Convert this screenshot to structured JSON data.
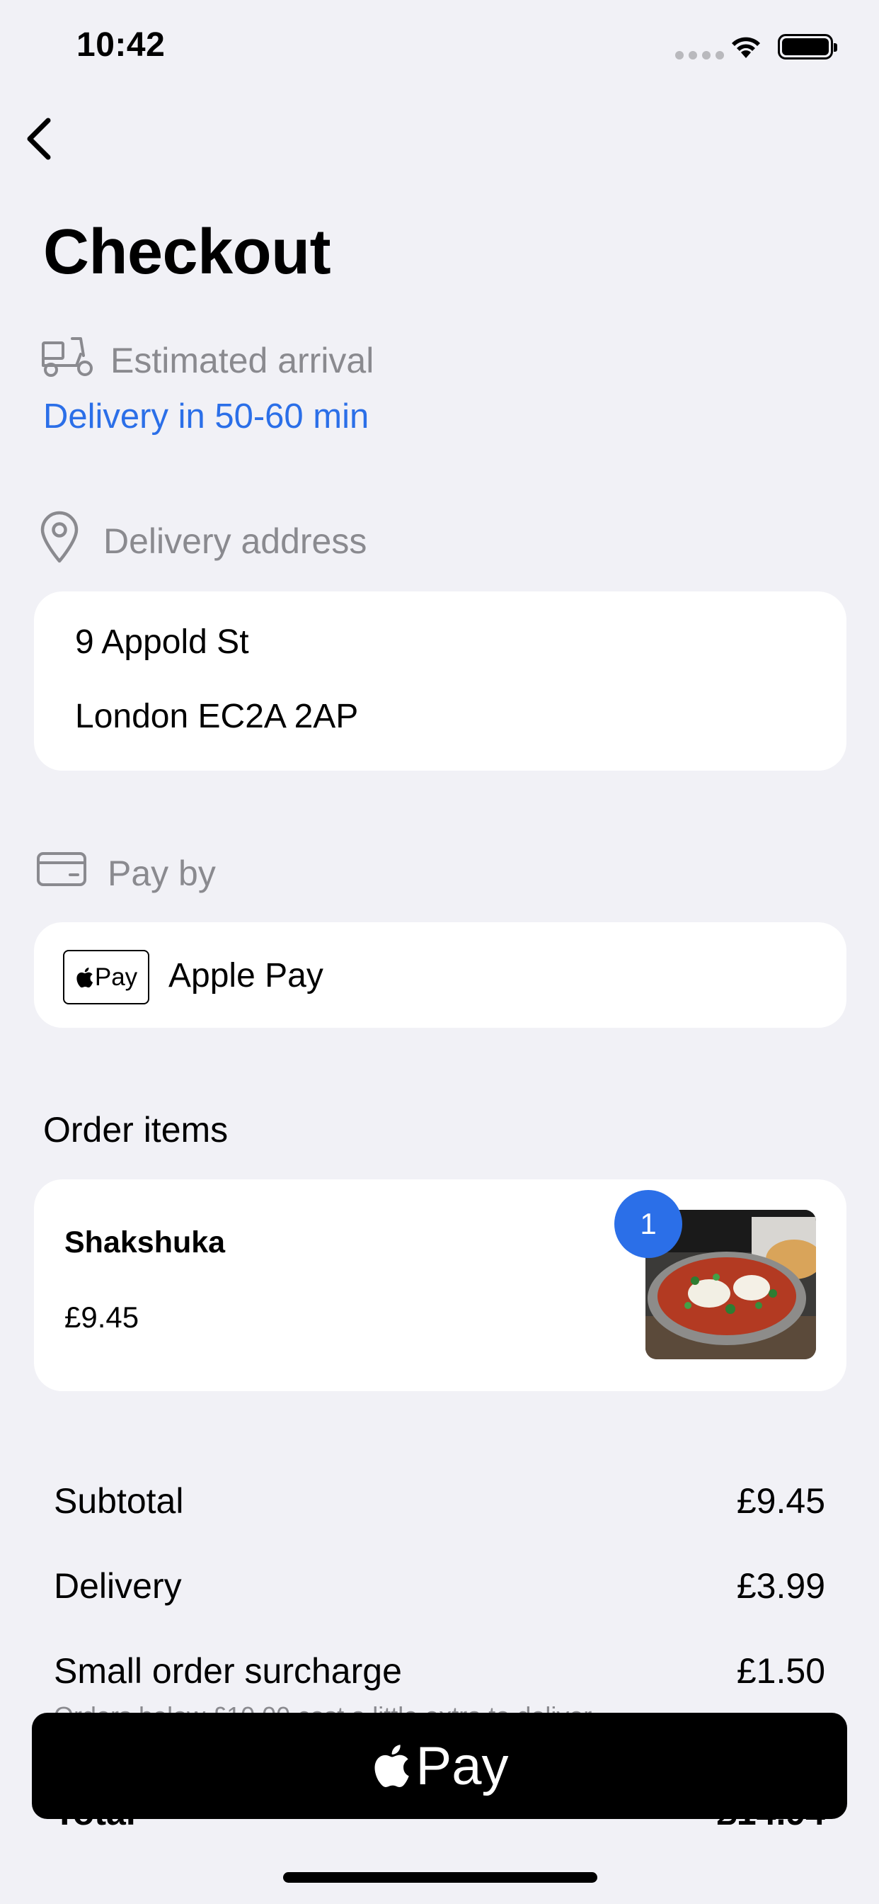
{
  "status_bar": {
    "time": "10:42"
  },
  "header": {
    "title": "Checkout"
  },
  "eta": {
    "label": "Estimated arrival",
    "value": "Delivery in 50-60 min"
  },
  "address": {
    "label": "Delivery address",
    "line1": "9 Appold St",
    "line2": "London  EC2A 2AP"
  },
  "payment": {
    "label": "Pay by",
    "badge_text": "Pay",
    "method": "Apple Pay"
  },
  "order": {
    "heading": "Order items",
    "items": [
      {
        "name": "Shakshuka",
        "price": "£9.45",
        "quantity": "1"
      }
    ]
  },
  "summary": {
    "subtotal_label": "Subtotal",
    "subtotal_value": "£9.45",
    "delivery_label": "Delivery",
    "delivery_value": "£3.99",
    "surcharge_label": "Small order surcharge",
    "surcharge_value": "£1.50",
    "surcharge_note": "Orders below £10.00 cost a little extra to deliver",
    "total_label": "Total",
    "total_value": "£14.94"
  },
  "pay_button": {
    "label": "Pay"
  },
  "colors": {
    "accent": "#2b6fe8",
    "background": "#f1f1f6",
    "muted": "#8a8a8f"
  }
}
